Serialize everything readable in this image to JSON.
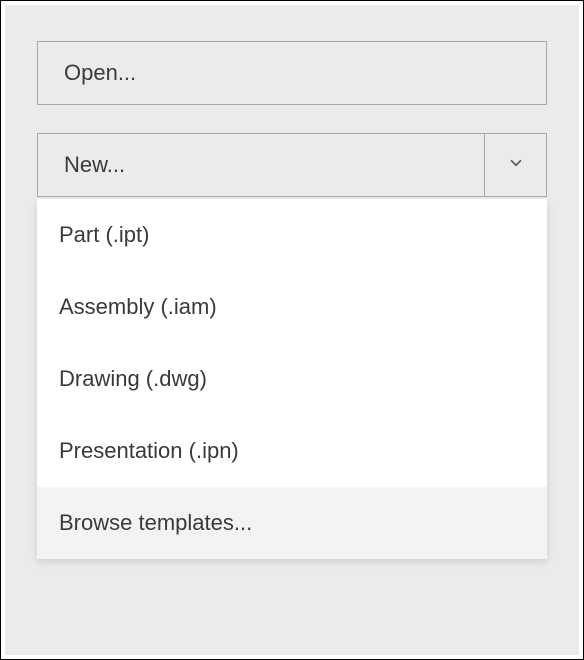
{
  "buttons": {
    "open": {
      "label": "Open..."
    },
    "new": {
      "label": "New..."
    }
  },
  "dropdown": {
    "items": [
      {
        "label": "Part (.ipt)"
      },
      {
        "label": "Assembly (.iam)"
      },
      {
        "label": "Drawing (.dwg)"
      },
      {
        "label": "Presentation (.ipn)"
      },
      {
        "label": "Browse templates..."
      }
    ]
  },
  "colors": {
    "panel_bg": "#ebebeb",
    "border": "#a8a8a8",
    "text": "#3a3a3a",
    "dropdown_bg": "#ffffff",
    "hover_bg": "#f3f3f3"
  }
}
